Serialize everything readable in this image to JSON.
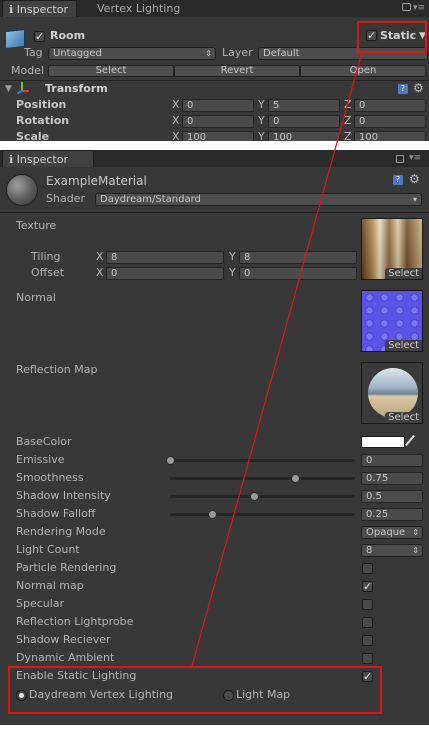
{
  "top_inspector": {
    "tabs": [
      "Inspector",
      "Vertex Lighting"
    ],
    "object_name": "Room",
    "object_active": true,
    "static_label": "Static",
    "static_checked": true,
    "tag_label": "Tag",
    "tag_value": "Untagged",
    "layer_label": "Layer",
    "layer_value": "Default",
    "model_label": "Model",
    "model_buttons": [
      "Select",
      "Revert",
      "Open"
    ],
    "transform_title": "Transform",
    "rows": [
      {
        "label": "Position",
        "x": "0",
        "y": "5",
        "z": "0"
      },
      {
        "label": "Rotation",
        "x": "0",
        "y": "0",
        "z": "0"
      },
      {
        "label": "Scale",
        "x": "100",
        "y": "100",
        "z": "100"
      }
    ],
    "axis": [
      "X",
      "Y",
      "Z"
    ]
  },
  "material_inspector": {
    "tab": "Inspector",
    "material_name": "ExampleMaterial",
    "shader_label": "Shader",
    "shader_value": "Daydream/Standard",
    "texture_label": "Texture",
    "tiling_label": "Tiling",
    "offset_label": "Offset",
    "tiling": {
      "x": "8",
      "y": "8"
    },
    "offset": {
      "x": "0",
      "y": "0"
    },
    "axis": [
      "X",
      "Y"
    ],
    "normal_label": "Normal",
    "reflection_label": "Reflection Map",
    "select_label": "Select",
    "basecolor_label": "BaseColor",
    "sliders": [
      {
        "label": "Emissive",
        "value": "0",
        "fraction": 0.0
      },
      {
        "label": "Smoothness",
        "value": "0.75",
        "fraction": 0.75
      },
      {
        "label": "Shadow Intensity",
        "value": "0.5",
        "fraction": 0.5
      },
      {
        "label": "Shadow Falloff",
        "value": "0.25",
        "fraction": 0.25
      }
    ],
    "rendering_mode_label": "Rendering Mode",
    "rendering_mode_value": "Opaque",
    "light_count_label": "Light Count",
    "light_count_value": "8",
    "toggles": [
      {
        "label": "Particle Rendering",
        "checked": false
      },
      {
        "label": "Normal map",
        "checked": true
      },
      {
        "label": "Specular",
        "checked": false
      },
      {
        "label": "Reflection Lightprobe",
        "checked": false
      },
      {
        "label": "Shadow Reciever",
        "checked": false
      },
      {
        "label": "Dynamic Ambient",
        "checked": false
      },
      {
        "label": "Enable Static Lighting",
        "checked": true
      }
    ],
    "lighting_options": [
      {
        "label": "Daydream Vertex Lighting",
        "selected": true
      },
      {
        "label": "Light Map",
        "selected": false
      }
    ]
  },
  "colors": {
    "panel": "#383838",
    "highlight": "#e01515",
    "text": "#b4b4b4"
  }
}
